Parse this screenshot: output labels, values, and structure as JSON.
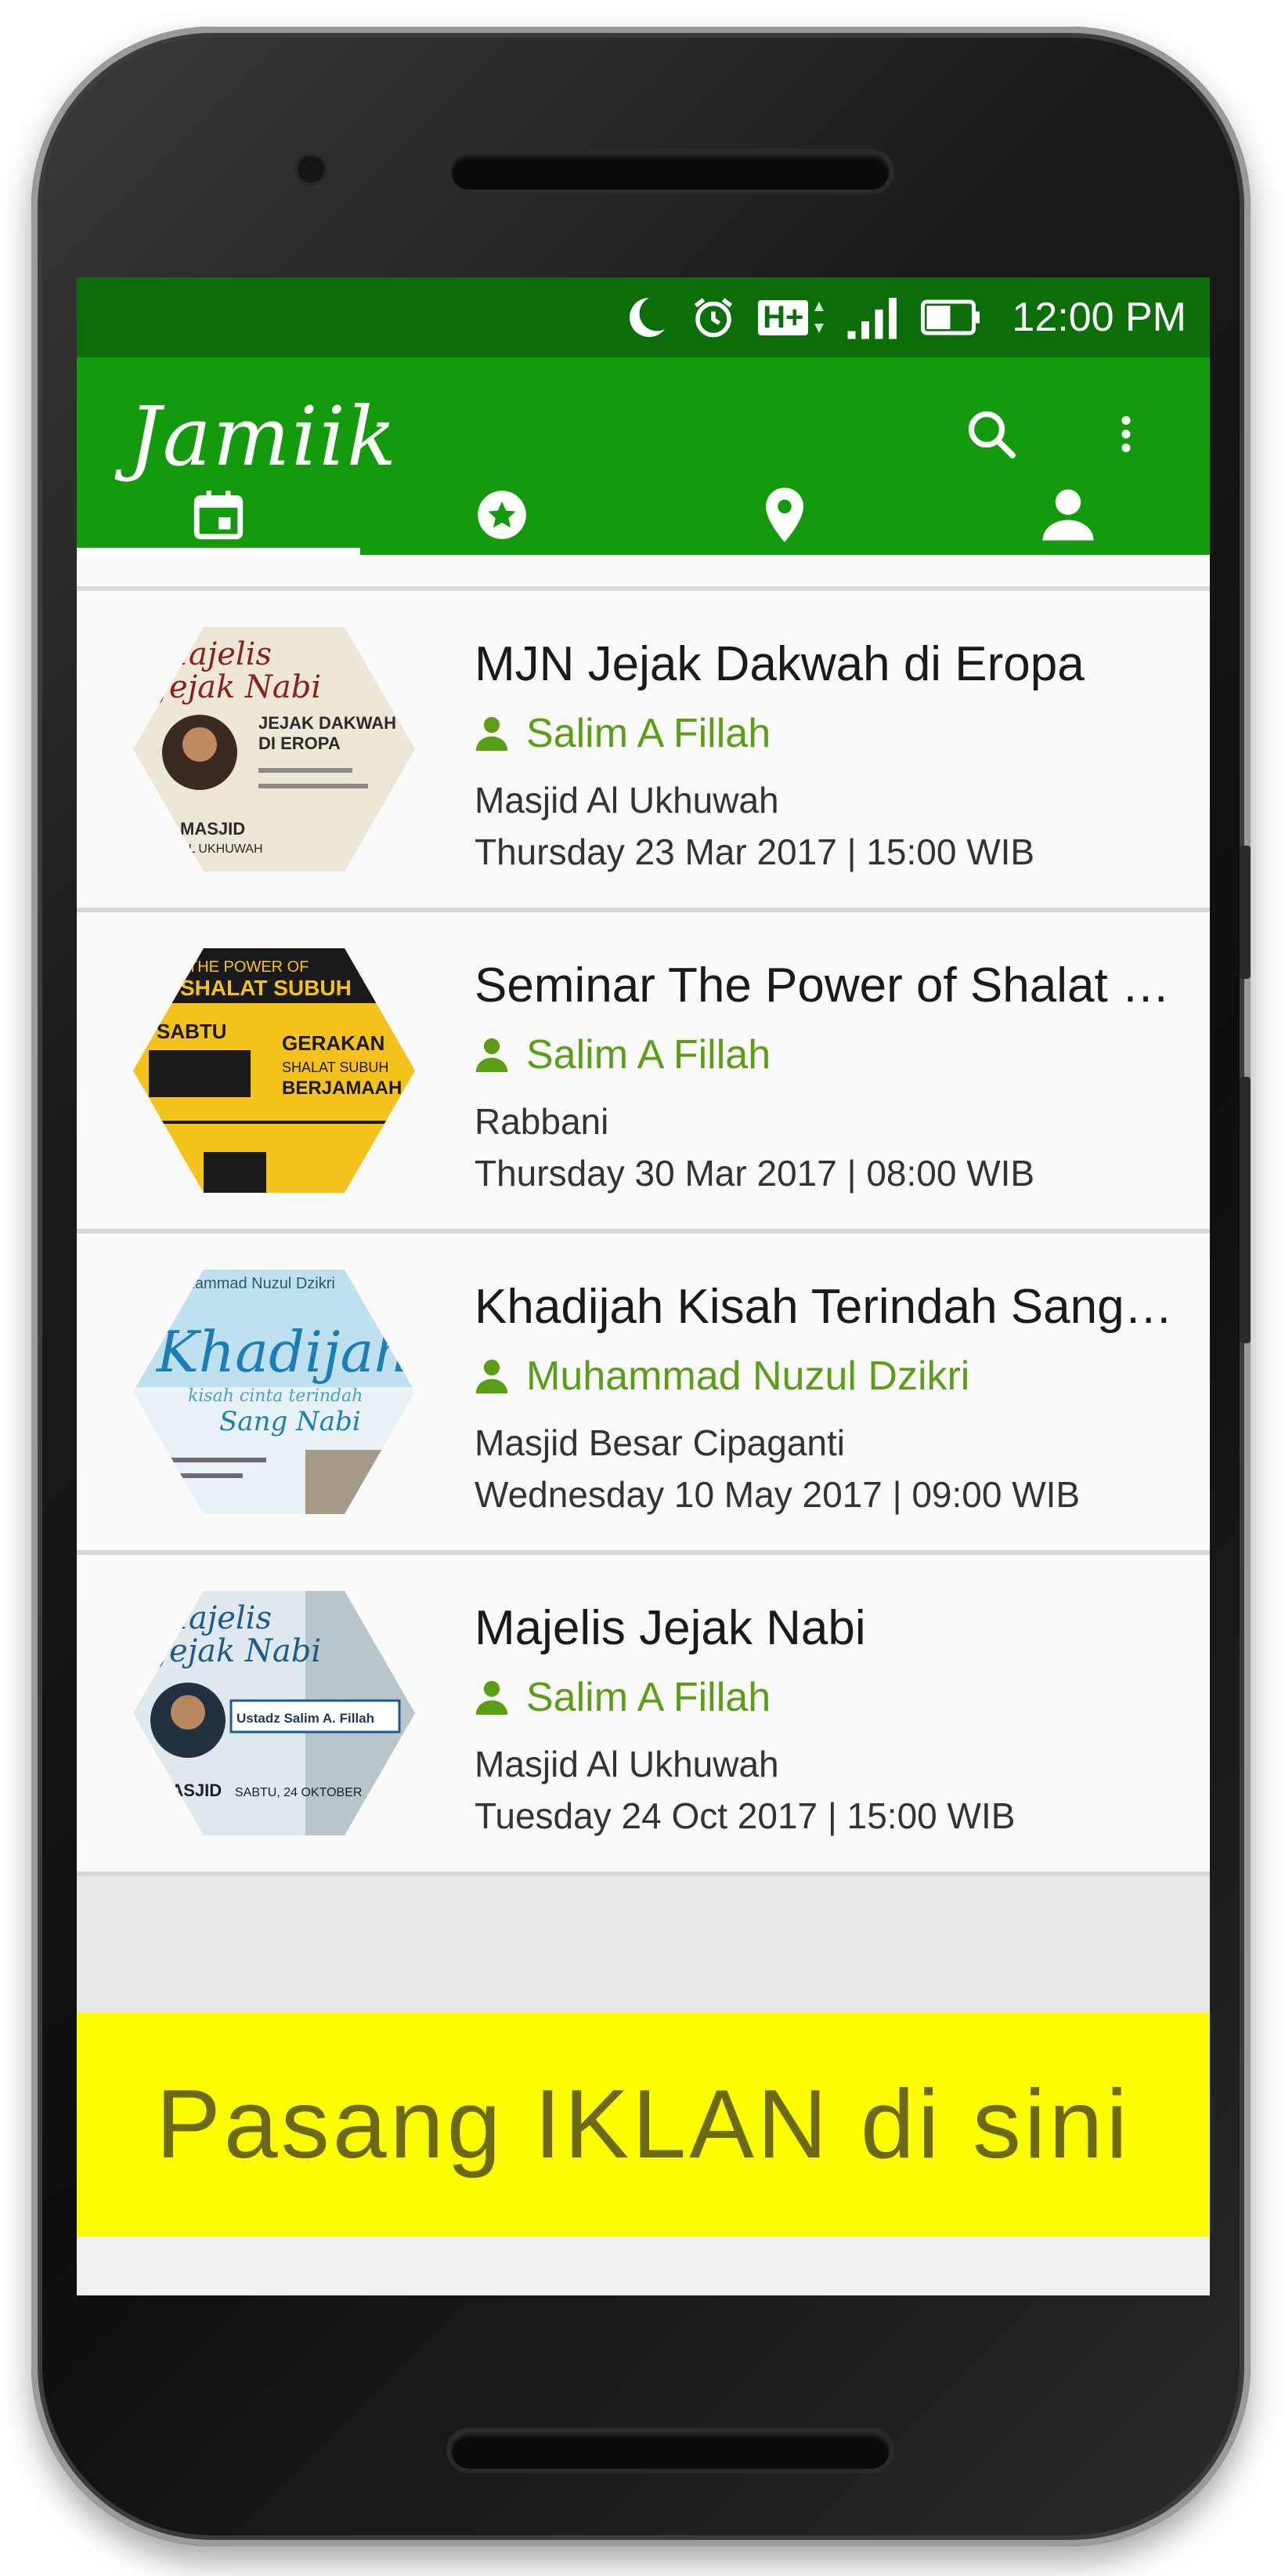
{
  "status_bar": {
    "time": "12:00 PM",
    "icons": [
      "moon-icon",
      "alarm-icon",
      "network-h-plus-icon",
      "signal-icon",
      "battery-icon"
    ],
    "network_label": "H+"
  },
  "app_bar": {
    "title": "Jamiik",
    "actions": [
      "search-icon",
      "more-vert-icon"
    ]
  },
  "tabs": [
    {
      "icon": "calendar-icon",
      "active": true
    },
    {
      "icon": "star-circle-icon",
      "active": false
    },
    {
      "icon": "location-pin-icon",
      "active": false
    },
    {
      "icon": "person-icon",
      "active": false
    }
  ],
  "events": [
    {
      "title": "MJN Jejak Dakwah di Eropa",
      "speaker": "Salim A Fillah",
      "venue": "Masjid Al Ukhuwah",
      "time": "Thursday 23 Mar 2017 | 15:00 WIB",
      "poster": {
        "bg": "#ece7d6",
        "accent": "#8a1f1f",
        "text": [
          "Majelis",
          "Jejak Nabi",
          "JEJAK DAKWAH",
          "DI EROPA",
          "MASJID",
          "AL UKHUWAH"
        ]
      }
    },
    {
      "title": "Seminar The Power of Shalat Subuh",
      "speaker": "Salim A Fillah",
      "venue": "Rabbani",
      "time": "Thursday 30 Mar 2017 | 08:00 WIB",
      "poster": {
        "bg": "#f4c21a",
        "accent": "#1a1a1a",
        "text": [
          "THE POWER OF",
          "SHALAT SUBUH",
          "SABTU",
          "GERAKAN",
          "SHALAT SUBUH",
          "BERJAMAAH"
        ]
      }
    },
    {
      "title": "Khadijah Kisah Terindah Sang Nabi",
      "speaker": "Muhammad Nuzul Dzikri",
      "venue": "Masjid Besar Cipaganti",
      "time": "Wednesday 10 May 2017 | 09:00 WIB",
      "poster": {
        "bg": "#e7f1f6",
        "accent": "#1b7fb5",
        "text": [
          "Muhammad Nuzul Dzikri",
          "Khadijah",
          "kisah cinta terindah",
          "Sang Nabi"
        ]
      }
    },
    {
      "title": "Majelis Jejak Nabi",
      "speaker": "Salim A Fillah",
      "venue": "Masjid Al Ukhuwah",
      "time": "Tuesday 24 Oct 2017 | 15:00 WIB",
      "poster": {
        "bg": "#dfe8ec",
        "accent": "#1e5a8a",
        "text": [
          "Majelis",
          "Jejak Nabi",
          "Ustadz Salim A. Fillah",
          "MASJID",
          "SABTU, 24 OKTOBER"
        ]
      }
    }
  ],
  "ad_banner": {
    "text": "Pasang IKLAN di sini"
  },
  "colors": {
    "status_bar": "#0b6e08",
    "app_bar": "#139a0d",
    "speaker_text": "#5a9e16",
    "ad_bg": "#fdfd00",
    "ad_text": "#6b6816"
  }
}
